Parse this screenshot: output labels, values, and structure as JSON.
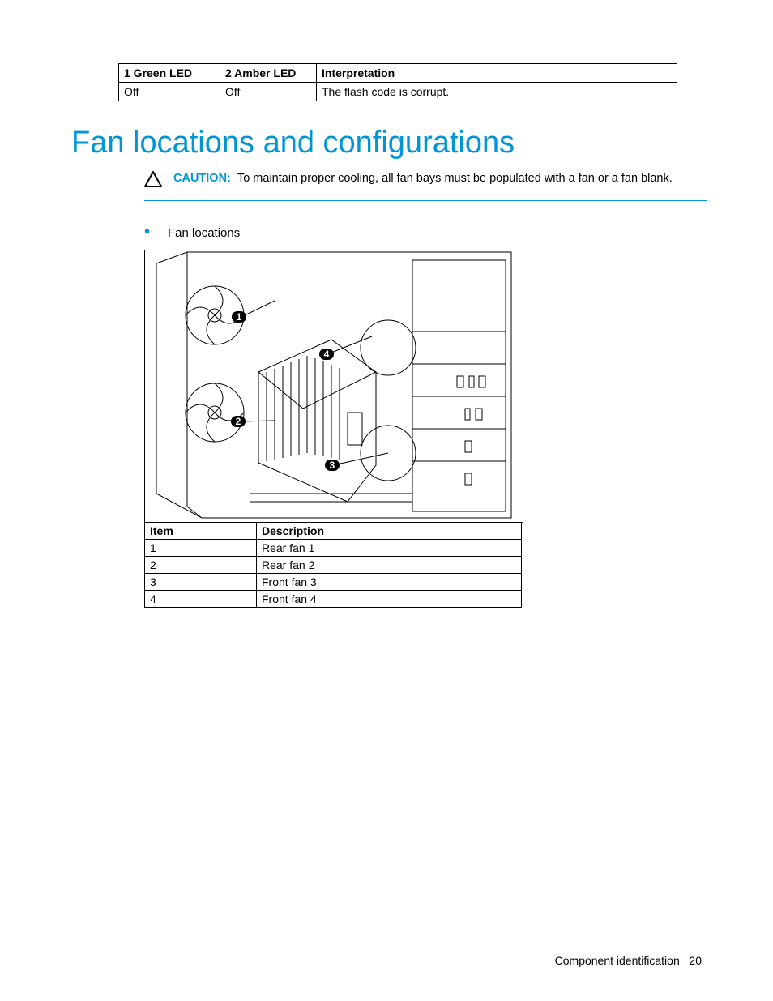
{
  "ledTable": {
    "headers": [
      "1 Green LED",
      "2 Amber LED",
      "Interpretation"
    ],
    "row": [
      "Off",
      "Off",
      "The flash code is corrupt."
    ]
  },
  "sectionTitle": "Fan locations and configurations",
  "caution": {
    "label": "CAUTION:",
    "text": "To maintain proper cooling, all fan bays must be populated with a fan or a fan blank."
  },
  "bulletText": "Fan locations",
  "callouts": {
    "one": "1",
    "two": "2",
    "three": "3",
    "four": "4"
  },
  "fanTable": {
    "headers": [
      "Item",
      "Description"
    ],
    "rows": [
      [
        "1",
        "Rear fan 1"
      ],
      [
        "2",
        "Rear fan 2"
      ],
      [
        "3",
        "Front fan 3"
      ],
      [
        "4",
        "Front fan 4"
      ]
    ]
  },
  "footer": {
    "section": "Component identification",
    "page": "20"
  }
}
